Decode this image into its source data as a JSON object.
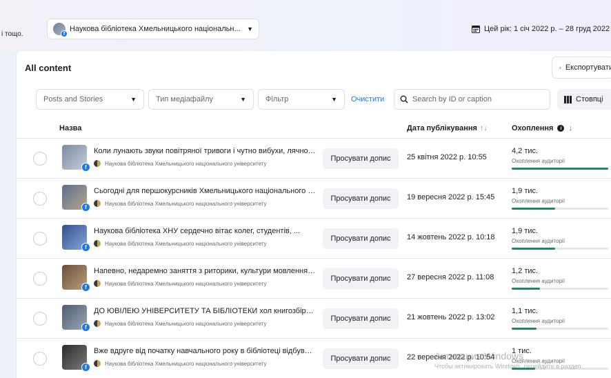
{
  "topbar": {
    "left_text": "і тощо.",
    "page_selector": "Наукова бібліотека Хмельницького національн...",
    "date_range": "Цей рік: 1 січ 2022 р. – 28 груд 2022 р"
  },
  "panel": {
    "title": "All content",
    "export_label": "Експортувати"
  },
  "filters": {
    "content_type": "Posts and Stories",
    "media_type": "Тип медіафайлу",
    "filter": "Фільтр",
    "clear": "Очистити",
    "search_placeholder": "Search by ID or caption",
    "columns": "Стовпці"
  },
  "table": {
    "headers": {
      "name": "Назва",
      "date": "Дата публікування",
      "reach": "Охоплення"
    },
    "promote_label": "Просувати допис",
    "reach_label": "Охоплення аудиторії",
    "page_name": "Наукова бібліотека Хмельницького національного університету",
    "rows": [
      {
        "title": "Коли лунають звуки повітряної тривоги і чутно вибухи, лячно н...",
        "date": "25 квітня 2022 р. 10:55",
        "reach": "4,2 тис.",
        "reach_share": 1.0
      },
      {
        "title": "Сьогодні для першокурсників Хмельницького національного ун...",
        "date": "19 вересня 2022 р. 15:45",
        "reach": "1,9 тис.",
        "reach_share": 0.45
      },
      {
        "title": "Наукова бібліотека ХНУ сердечно вітає колег, студентів, ...",
        "date": "14 жовтень 2022 р. 10:18",
        "reach": "1,9 тис.",
        "reach_share": 0.45
      },
      {
        "title": "Напевно, недаремно заняття з риторики, культури мовлення і с...",
        "date": "27 вересня 2022 р. 11:08",
        "reach": "1,2 тис.",
        "reach_share": 0.29
      },
      {
        "title": "ДО ЮВІЛЕЮ УНІВЕРСИТЕТУ ТА БІБЛІОТЕКИ хол книгозбірні при...",
        "date": "21 жовтень 2022 р. 13:02",
        "reach": "1,1 тис.",
        "reach_share": 0.26
      },
      {
        "title": "Вже вдруге від початку навчального року в бібліотеці відбувся ...",
        "date": "22 вересня 2022 р. 10:54",
        "reach": "1 тис.",
        "reach_share": 0.24
      }
    ]
  },
  "watermark": {
    "line1": "Активация Windows",
    "line2": "Чтобы активировать Windows, перейдите в раздел"
  },
  "colors": {
    "accent": "#1877f2",
    "reach_bar": "#1b8a5a"
  }
}
